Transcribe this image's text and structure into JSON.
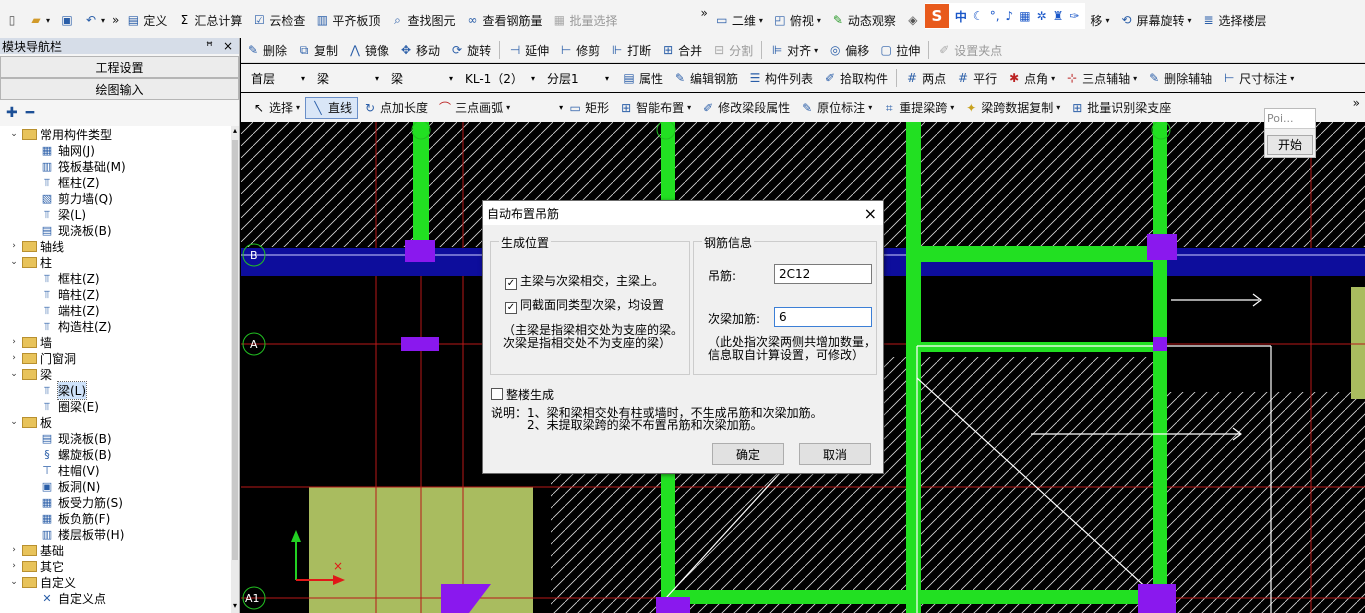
{
  "toolbar1": {
    "items": [
      "定义",
      "汇总计算",
      "云检查",
      "平齐板顶",
      "查找图元",
      "查看钢筋量",
      "批量选择"
    ],
    "view_mode": "二维",
    "view_dir": "俯视",
    "dynamic": "动态观察",
    "move_partial": "移",
    "rotate_screen": "屏幕旋转",
    "select_floor": "选择楼层",
    "ime_items": [
      "中"
    ]
  },
  "left_panel": {
    "title": "模块导航栏",
    "pin": "ꟸ",
    "close": "×",
    "btn_project": "工程设置",
    "btn_draw": "绘图输入",
    "tree": [
      {
        "level": 0,
        "expand": "⌄",
        "type": "folder",
        "label": "常用构件类型"
      },
      {
        "level": 1,
        "icon": "▦",
        "label": "轴网(J)"
      },
      {
        "level": 1,
        "icon": "▥",
        "label": "筏板基础(M)"
      },
      {
        "level": 1,
        "icon": "⫪",
        "label": "框柱(Z)"
      },
      {
        "level": 1,
        "icon": "▧",
        "label": "剪力墙(Q)"
      },
      {
        "level": 1,
        "icon": "⫪",
        "label": "梁(L)"
      },
      {
        "level": 1,
        "icon": "▤",
        "label": "现浇板(B)"
      },
      {
        "level": 0,
        "expand": "›",
        "type": "folder",
        "label": "轴线"
      },
      {
        "level": 0,
        "expand": "⌄",
        "type": "folder",
        "label": "柱"
      },
      {
        "level": 1,
        "icon": "⫪",
        "label": "框柱(Z)"
      },
      {
        "level": 1,
        "icon": "⫪",
        "label": "暗柱(Z)"
      },
      {
        "level": 1,
        "icon": "⫪",
        "label": "端柱(Z)"
      },
      {
        "level": 1,
        "icon": "⫪",
        "label": "构造柱(Z)"
      },
      {
        "level": 0,
        "expand": "›",
        "type": "folder",
        "label": "墙"
      },
      {
        "level": 0,
        "expand": "›",
        "type": "folder",
        "label": "门窗洞"
      },
      {
        "level": 0,
        "expand": "⌄",
        "type": "folder",
        "label": "梁"
      },
      {
        "level": 1,
        "icon": "⫪",
        "label": "梁(L)",
        "selected": true
      },
      {
        "level": 1,
        "icon": "⫪",
        "label": "圈梁(E)"
      },
      {
        "level": 0,
        "expand": "⌄",
        "type": "folder",
        "label": "板"
      },
      {
        "level": 1,
        "icon": "▤",
        "label": "现浇板(B)"
      },
      {
        "level": 1,
        "icon": "§",
        "label": "螺旋板(B)"
      },
      {
        "level": 1,
        "icon": "⊤",
        "label": "柱帽(V)"
      },
      {
        "level": 1,
        "icon": "▣",
        "label": "板洞(N)"
      },
      {
        "level": 1,
        "icon": "▦",
        "label": "板受力筋(S)"
      },
      {
        "level": 1,
        "icon": "▦",
        "label": "板负筋(F)"
      },
      {
        "level": 1,
        "icon": "▥",
        "label": "楼层板带(H)"
      },
      {
        "level": 0,
        "expand": "›",
        "type": "folder",
        "label": "基础"
      },
      {
        "level": 0,
        "expand": "›",
        "type": "folder",
        "label": "其它"
      },
      {
        "level": 0,
        "expand": "⌄",
        "type": "folder",
        "label": "自定义"
      },
      {
        "level": 1,
        "icon": "✕",
        "label": "自定义点"
      }
    ]
  },
  "toolbar2": {
    "items": [
      "删除",
      "复制",
      "镜像",
      "移动",
      "旋转",
      "延伸",
      "修剪",
      "打断",
      "合并",
      "分割",
      "对齐",
      "偏移",
      "拉伸",
      "设置夹点"
    ]
  },
  "toolbar3": {
    "floor": "首层",
    "type1": "梁",
    "type2": "梁",
    "name": "KL-1（2）",
    "layer": "分层1",
    "items": [
      "属性",
      "编辑钢筋",
      "构件列表",
      "拾取构件",
      "两点",
      "平行",
      "点角",
      "三点辅轴",
      "删除辅轴",
      "尺寸标注"
    ]
  },
  "toolbar4": {
    "items": [
      "选择",
      "直线",
      "点加长度",
      "三点画弧",
      "矩形",
      "智能布置",
      "修改梁段属性",
      "原位标注",
      "重提梁跨",
      "梁跨数据复制",
      "批量识别梁支座"
    ]
  },
  "float_box": {
    "input": "Poi...",
    "button": "开始"
  },
  "dialog": {
    "title": "自动布置吊筋",
    "close": "×",
    "group_pos": "生成位置",
    "check1": "主梁与次梁相交，主梁上。",
    "check1_state": "✓",
    "check2": "同截面同类型次梁，均设置",
    "check2_state": "✓",
    "note_pos": "（主梁是指梁相交处为支座的梁。次梁是指相交处不为支座的梁）",
    "group_rebar": "钢筋信息",
    "label_hanger": "吊筋:",
    "value_hanger": "2C12",
    "label_extra": "次梁加筋:",
    "value_extra": "6",
    "note_rebar": "（此处指次梁两侧共增加数量，信息取自计算设置，可修改）",
    "whole_building": "整楼生成",
    "note": "说明：1、梁和梁相交处有柱或墙时，不生成吊筋和次梁加筋。",
    "note2": "2、未提取梁跨的梁不布置吊筋和次梁加筋。",
    "ok": "确定",
    "cancel": "取消"
  },
  "canvas": {
    "axis_labels": [
      "B",
      "A",
      "A1"
    ],
    "colors": {
      "beam_green": "#22e022",
      "beam_blue": "#0d0d9c",
      "column_purple": "#8a18ee",
      "slab_olive": "#a9bc5f",
      "grid_red": "#b81818"
    }
  }
}
